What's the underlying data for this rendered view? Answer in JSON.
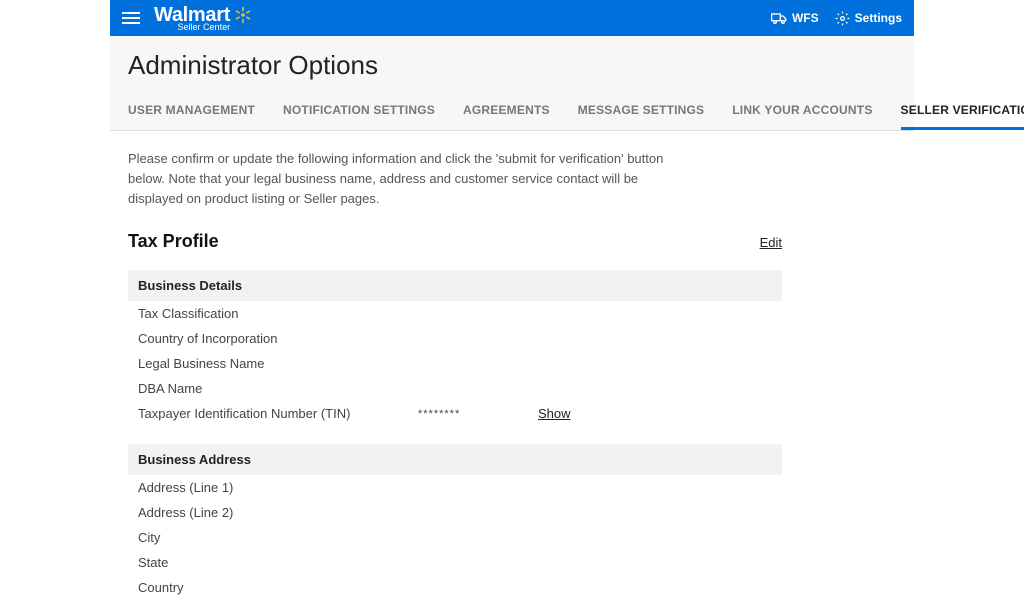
{
  "header": {
    "brand_name": "Walmart",
    "brand_sub": "Seller Center",
    "wfs_label": "WFS",
    "settings_label": "Settings"
  },
  "page": {
    "title": "Administrator Options",
    "intro": "Please confirm or update the following information and click the 'submit for verification' button below. Note that your legal business name, address and customer service contact will be displayed on product listing or Seller pages."
  },
  "tabs": [
    {
      "label": "USER MANAGEMENT"
    },
    {
      "label": "NOTIFICATION SETTINGS"
    },
    {
      "label": "AGREEMENTS"
    },
    {
      "label": "MESSAGE SETTINGS"
    },
    {
      "label": "LINK YOUR ACCOUNTS"
    },
    {
      "label": "SELLER VERIFICATION"
    }
  ],
  "active_tab_index": 5,
  "tax_profile": {
    "title": "Tax Profile",
    "edit_label": "Edit",
    "business_details": {
      "header": "Business Details",
      "fields": {
        "tax_classification": "Tax Classification",
        "country_of_incorporation": "Country of Incorporation",
        "legal_business_name": "Legal Business Name",
        "dba_name": "DBA Name",
        "tin_label": "Taxpayer Identification Number (TIN)",
        "tin_masked": "********",
        "show_label": "Show"
      }
    },
    "business_address": {
      "header": "Business Address",
      "fields": {
        "address1": "Address (Line 1)",
        "address2": "Address (Line 2)",
        "city": "City",
        "state": "State",
        "country": "Country"
      }
    }
  }
}
